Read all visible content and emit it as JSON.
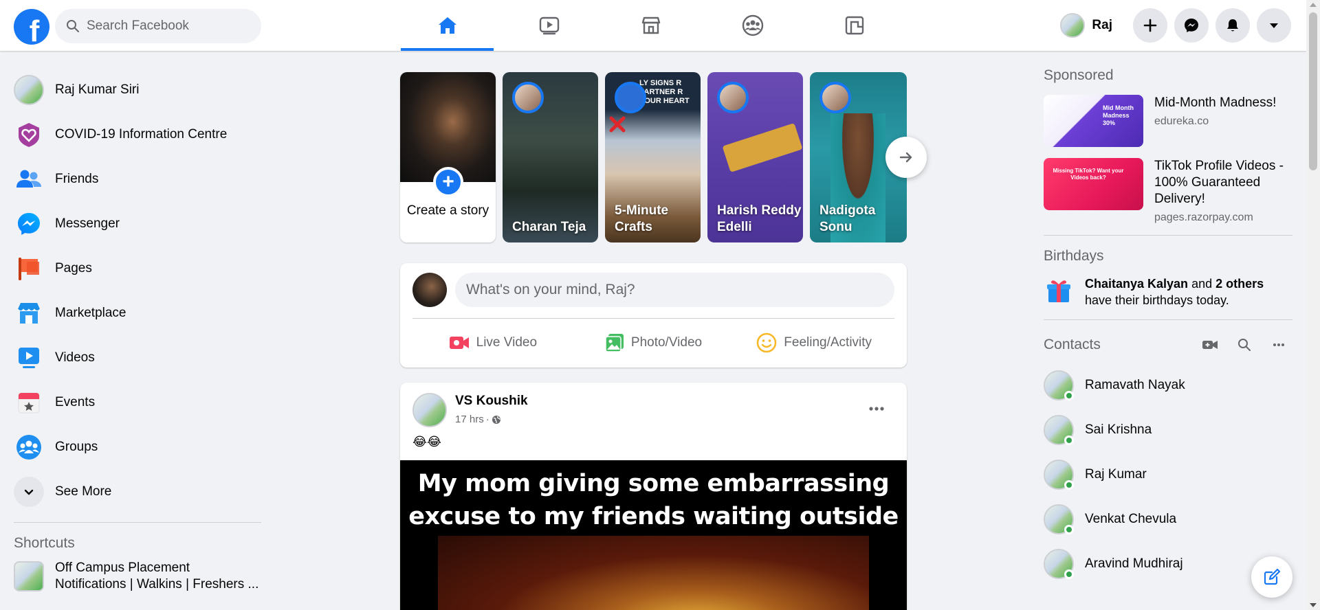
{
  "header": {
    "logo_letter": "f",
    "search_placeholder": "Search Facebook",
    "nav_tabs": [
      {
        "name": "home",
        "icon": "home-icon",
        "active": true
      },
      {
        "name": "watch",
        "icon": "video-icon",
        "active": false
      },
      {
        "name": "marketplace",
        "icon": "shop-icon",
        "active": false
      },
      {
        "name": "groups",
        "icon": "groups-icon",
        "active": false
      },
      {
        "name": "gaming",
        "icon": "gaming-icon",
        "active": false
      }
    ],
    "profile_name": "Raj",
    "actions": [
      "plus-icon",
      "messenger-icon",
      "bell-icon",
      "caret-down-icon"
    ]
  },
  "left_nav": {
    "items": [
      {
        "label": "Raj Kumar Siri",
        "icon": "avatar"
      },
      {
        "label": "COVID-19 Information Centre",
        "icon": "covid-heart-icon"
      },
      {
        "label": "Friends",
        "icon": "friends-icon"
      },
      {
        "label": "Messenger",
        "icon": "messenger-icon"
      },
      {
        "label": "Pages",
        "icon": "flag-icon"
      },
      {
        "label": "Marketplace",
        "icon": "shop-icon"
      },
      {
        "label": "Videos",
        "icon": "video-icon"
      },
      {
        "label": "Events",
        "icon": "calendar-icon"
      },
      {
        "label": "Groups",
        "icon": "groups-icon"
      },
      {
        "label": "See More",
        "icon": "chevron-down-icon"
      }
    ],
    "shortcuts_title": "Shortcuts",
    "shortcuts": [
      {
        "label": "Off Campus Placement Notifications | Walkins | Freshers ..."
      }
    ]
  },
  "stories": {
    "create_label": "Create a story",
    "items": [
      {
        "name": "Charan Teja"
      },
      {
        "name": "5-Minute Crafts",
        "overlay_text": "LY SIGNS R PARTNER R YOUR HEART"
      },
      {
        "name": "Harish Reddy Edelli"
      },
      {
        "name": "Nadigota Sonu"
      }
    ]
  },
  "composer": {
    "placeholder": "What's on your mind, Raj?",
    "actions": [
      {
        "label": "Live Video",
        "icon": "live-video-icon",
        "color": "#f3425f"
      },
      {
        "label": "Photo/Video",
        "icon": "photo-icon",
        "color": "#45bd62"
      },
      {
        "label": "Feeling/Activity",
        "icon": "feeling-icon",
        "color": "#f7b928"
      }
    ]
  },
  "post": {
    "author": "VS Koushik",
    "time": "17 hrs",
    "audience_icon": "globe-icon",
    "text": "😂😂",
    "media_caption_line1": "My mom giving some embarrassing",
    "media_caption_line2": "excuse to my friends waiting outside"
  },
  "right_col": {
    "sponsored_title": "Sponsored",
    "ads": [
      {
        "title": "Mid-Month Madness!",
        "url": "edureka.co",
        "image_text": "Mid Month Madness 30%"
      },
      {
        "title": "TikTok Profile Videos - 100% Guaranteed Delivery!",
        "url": "pages.razorpay.com",
        "image_text": "Missing TikTok? Want your Videos back?"
      }
    ],
    "birthdays_title": "Birthdays",
    "birthday_name": "Chaitanya Kalyan",
    "birthday_others": "2 others",
    "birthday_and": "and",
    "birthday_suffix": "have their birthdays today.",
    "contacts_title": "Contacts",
    "contacts": [
      {
        "name": "Ramavath Nayak"
      },
      {
        "name": "Sai Krishna"
      },
      {
        "name": "Raj Kumar"
      },
      {
        "name": "Venkat Chevula"
      },
      {
        "name": "Aravind Mudhiraj"
      }
    ]
  },
  "colors": {
    "brand": "#1877f2",
    "background": "#f0f2f5",
    "online": "#31a24c"
  }
}
